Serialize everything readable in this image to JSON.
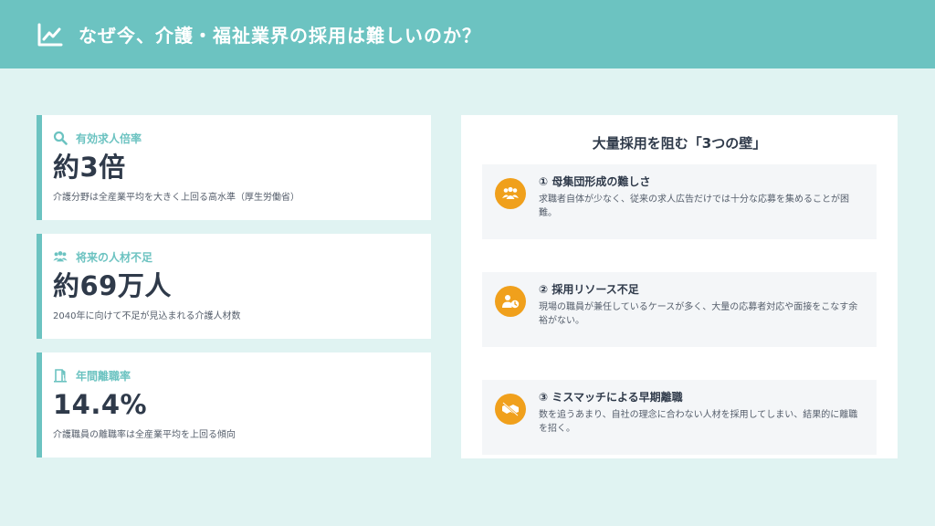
{
  "header": {
    "title": "なぜ今、介護・福祉業界の採用は難しいのか？",
    "icon": "chart-line-icon"
  },
  "stats": [
    {
      "icon": "search-icon",
      "label": "有効求人倍率",
      "value": "約3倍",
      "description": "介護分野は全産業平均を大きく上回る高水準（厚生労働省）"
    },
    {
      "icon": "people-group-icon",
      "label": "将来の人材不足",
      "value": "約69万人",
      "description": "2040年に向けて不足が見込まれる介護人材数"
    },
    {
      "icon": "door-exit-icon",
      "label": "年間離職率",
      "value": "14.4%",
      "description": "介護職員の離職率は全産業平均を上回る傾向"
    }
  ],
  "walls_panel": {
    "title": "大量採用を阻む「3つの壁」",
    "items": [
      {
        "icon": "users-group-icon",
        "title": "① 母集団形成の難しさ",
        "description": "求職者自体が少なく、従来の求人広告だけでは十分な応募を集めることが困難。"
      },
      {
        "icon": "user-clock-icon",
        "title": "② 採用リソース不足",
        "description": "現場の職員が兼任しているケースが多く、大量の応募者対応や面接をこなす余裕がない。"
      },
      {
        "icon": "handshake-slash-icon",
        "title": "③ ミスマッチによる早期離職",
        "description": "数を追うあまり、自社の理念に合わない人材を採用してしまい、結果的に離職を招く。"
      }
    ]
  },
  "colors": {
    "teal": "#6cc3c1",
    "background": "#e0f3f2",
    "orange": "#f0a01c",
    "text_dark": "#2f3a4a"
  }
}
